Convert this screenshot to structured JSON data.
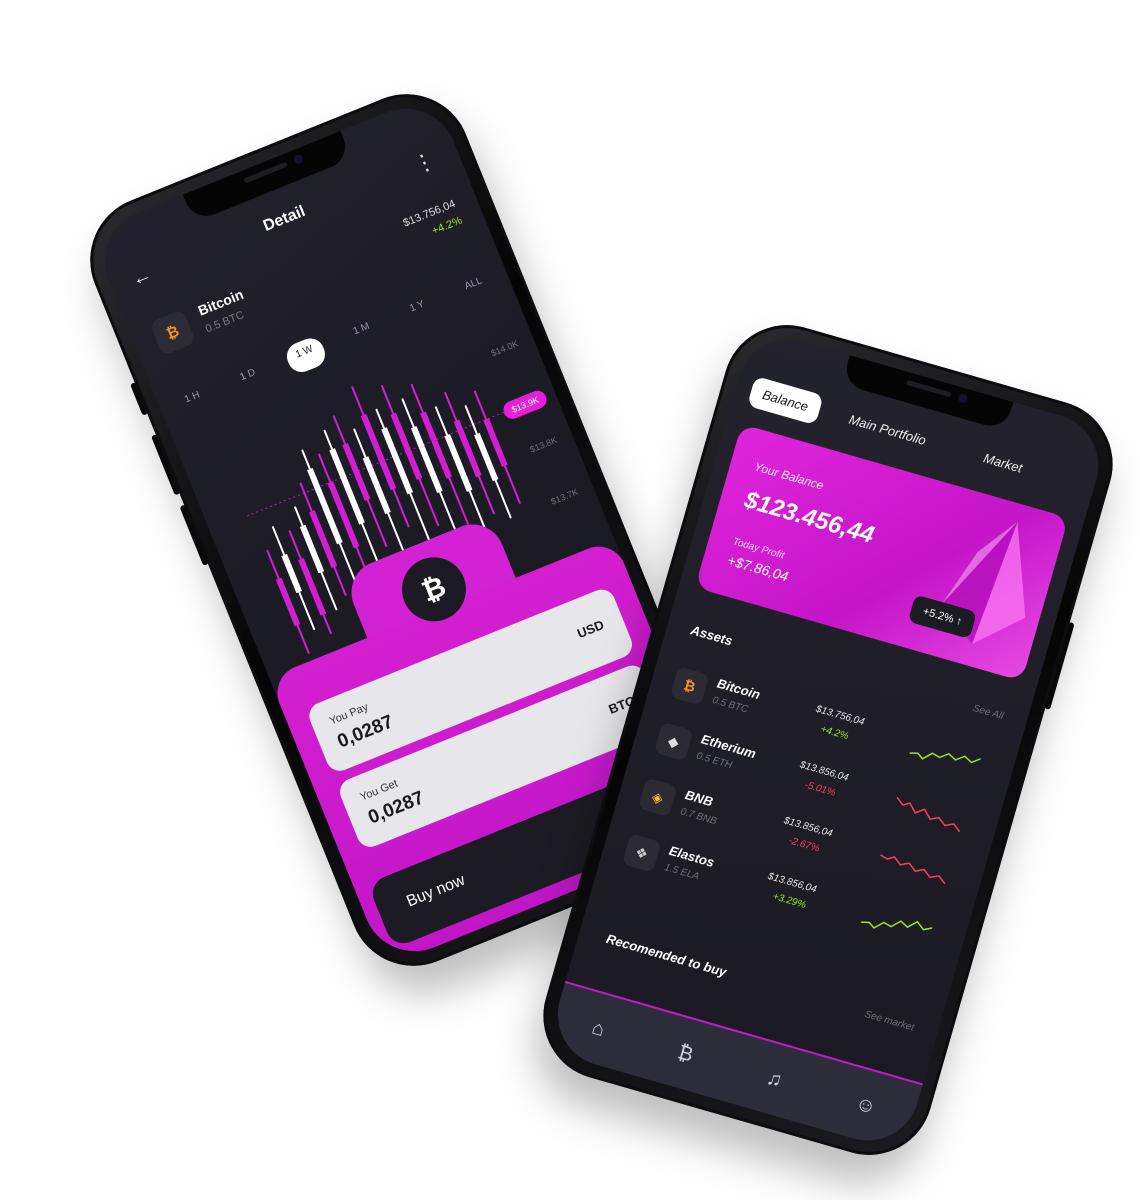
{
  "detail": {
    "title": "Detail",
    "coin_name": "Bitcoin",
    "coin_qty": "0.5 BTC",
    "price": "$13.756,04",
    "change": "+4.2%",
    "timeframes": [
      "1 H",
      "1 D",
      "1 W",
      "1 M",
      "1 Y",
      "ALL"
    ],
    "active_timeframe": "1 W",
    "y_labels": [
      "$14.0K",
      "$13.8K",
      "$13.7K"
    ],
    "tag": "$13.9K",
    "you_pay_label": "You Pay",
    "you_pay_value": "0,0287",
    "you_pay_currency": "USD",
    "you_get_label": "You Get",
    "you_get_value": "0,0287",
    "you_get_currency": "BTC",
    "buy_label": "Buy now",
    "accent": "#d31fd0"
  },
  "portfolio": {
    "tabs": [
      "Balance",
      "Main Portfolio",
      "Market"
    ],
    "balance_label": "Your Balance",
    "balance_value": "$123.456,44",
    "profit_label": "Today Profit",
    "profit_value": "+$7.86,04",
    "profit_pill": "+5.2%",
    "assets_title": "Assets",
    "see_all": "See All",
    "assets": [
      {
        "name": "Bitcoin",
        "qty": "0.5 BTC",
        "price": "$13.756,04",
        "change": "+4.2%",
        "up": true,
        "icon": "bitcoin-icon"
      },
      {
        "name": "Etherium",
        "qty": "0.5 ETH",
        "price": "$13.856,04",
        "change": "-5.01%",
        "up": false,
        "icon": "ethereum-icon"
      },
      {
        "name": "BNB",
        "qty": "0.7 BNB",
        "price": "$13.856,04",
        "change": "-2.67%",
        "up": false,
        "icon": "bnb-icon"
      },
      {
        "name": "Elastos",
        "qty": "1.5 ELA",
        "price": "$13.856,04",
        "change": "+3.29%",
        "up": true,
        "icon": "elastos-icon"
      }
    ],
    "recommended_title": "Recomended to buy",
    "see_market": "See market",
    "nav": [
      "home-icon",
      "bitcoin-icon",
      "bell-icon",
      "profile-icon"
    ]
  }
}
